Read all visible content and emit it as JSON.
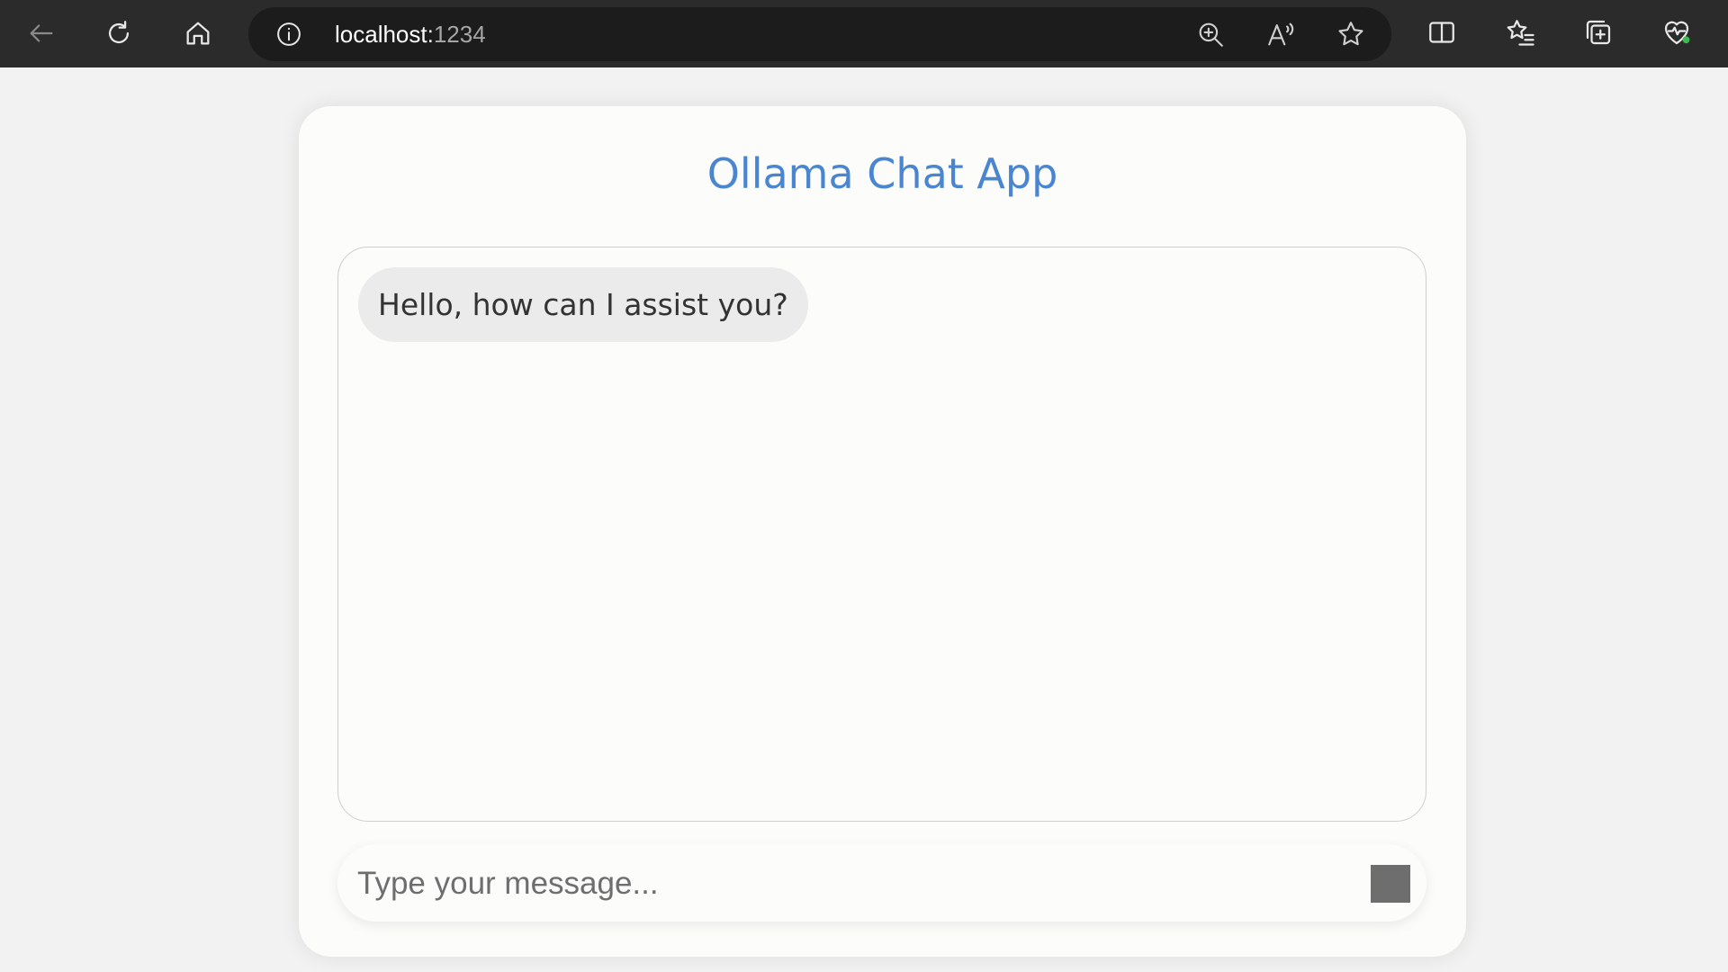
{
  "browser": {
    "url_host": "localhost:",
    "url_port": "1234",
    "icons": [
      "back-arrow-icon",
      "refresh-icon",
      "home-icon",
      "info-icon",
      "zoom-in-icon",
      "read-aloud-icon",
      "favorite-star-icon",
      "split-screen-icon",
      "favorites-icon",
      "collections-icon",
      "browser-essentials-icon"
    ]
  },
  "app": {
    "title": "Ollama Chat App",
    "messages": [
      {
        "role": "assistant",
        "text": "Hello, how can I assist you?"
      }
    ],
    "input": {
      "value": "",
      "placeholder": "Type your message..."
    }
  },
  "colors": {
    "title": "#4a86d0",
    "bubble": "#ebebeb",
    "send_button": "#6e6e6e",
    "toolbar": "#2b2b2b"
  }
}
